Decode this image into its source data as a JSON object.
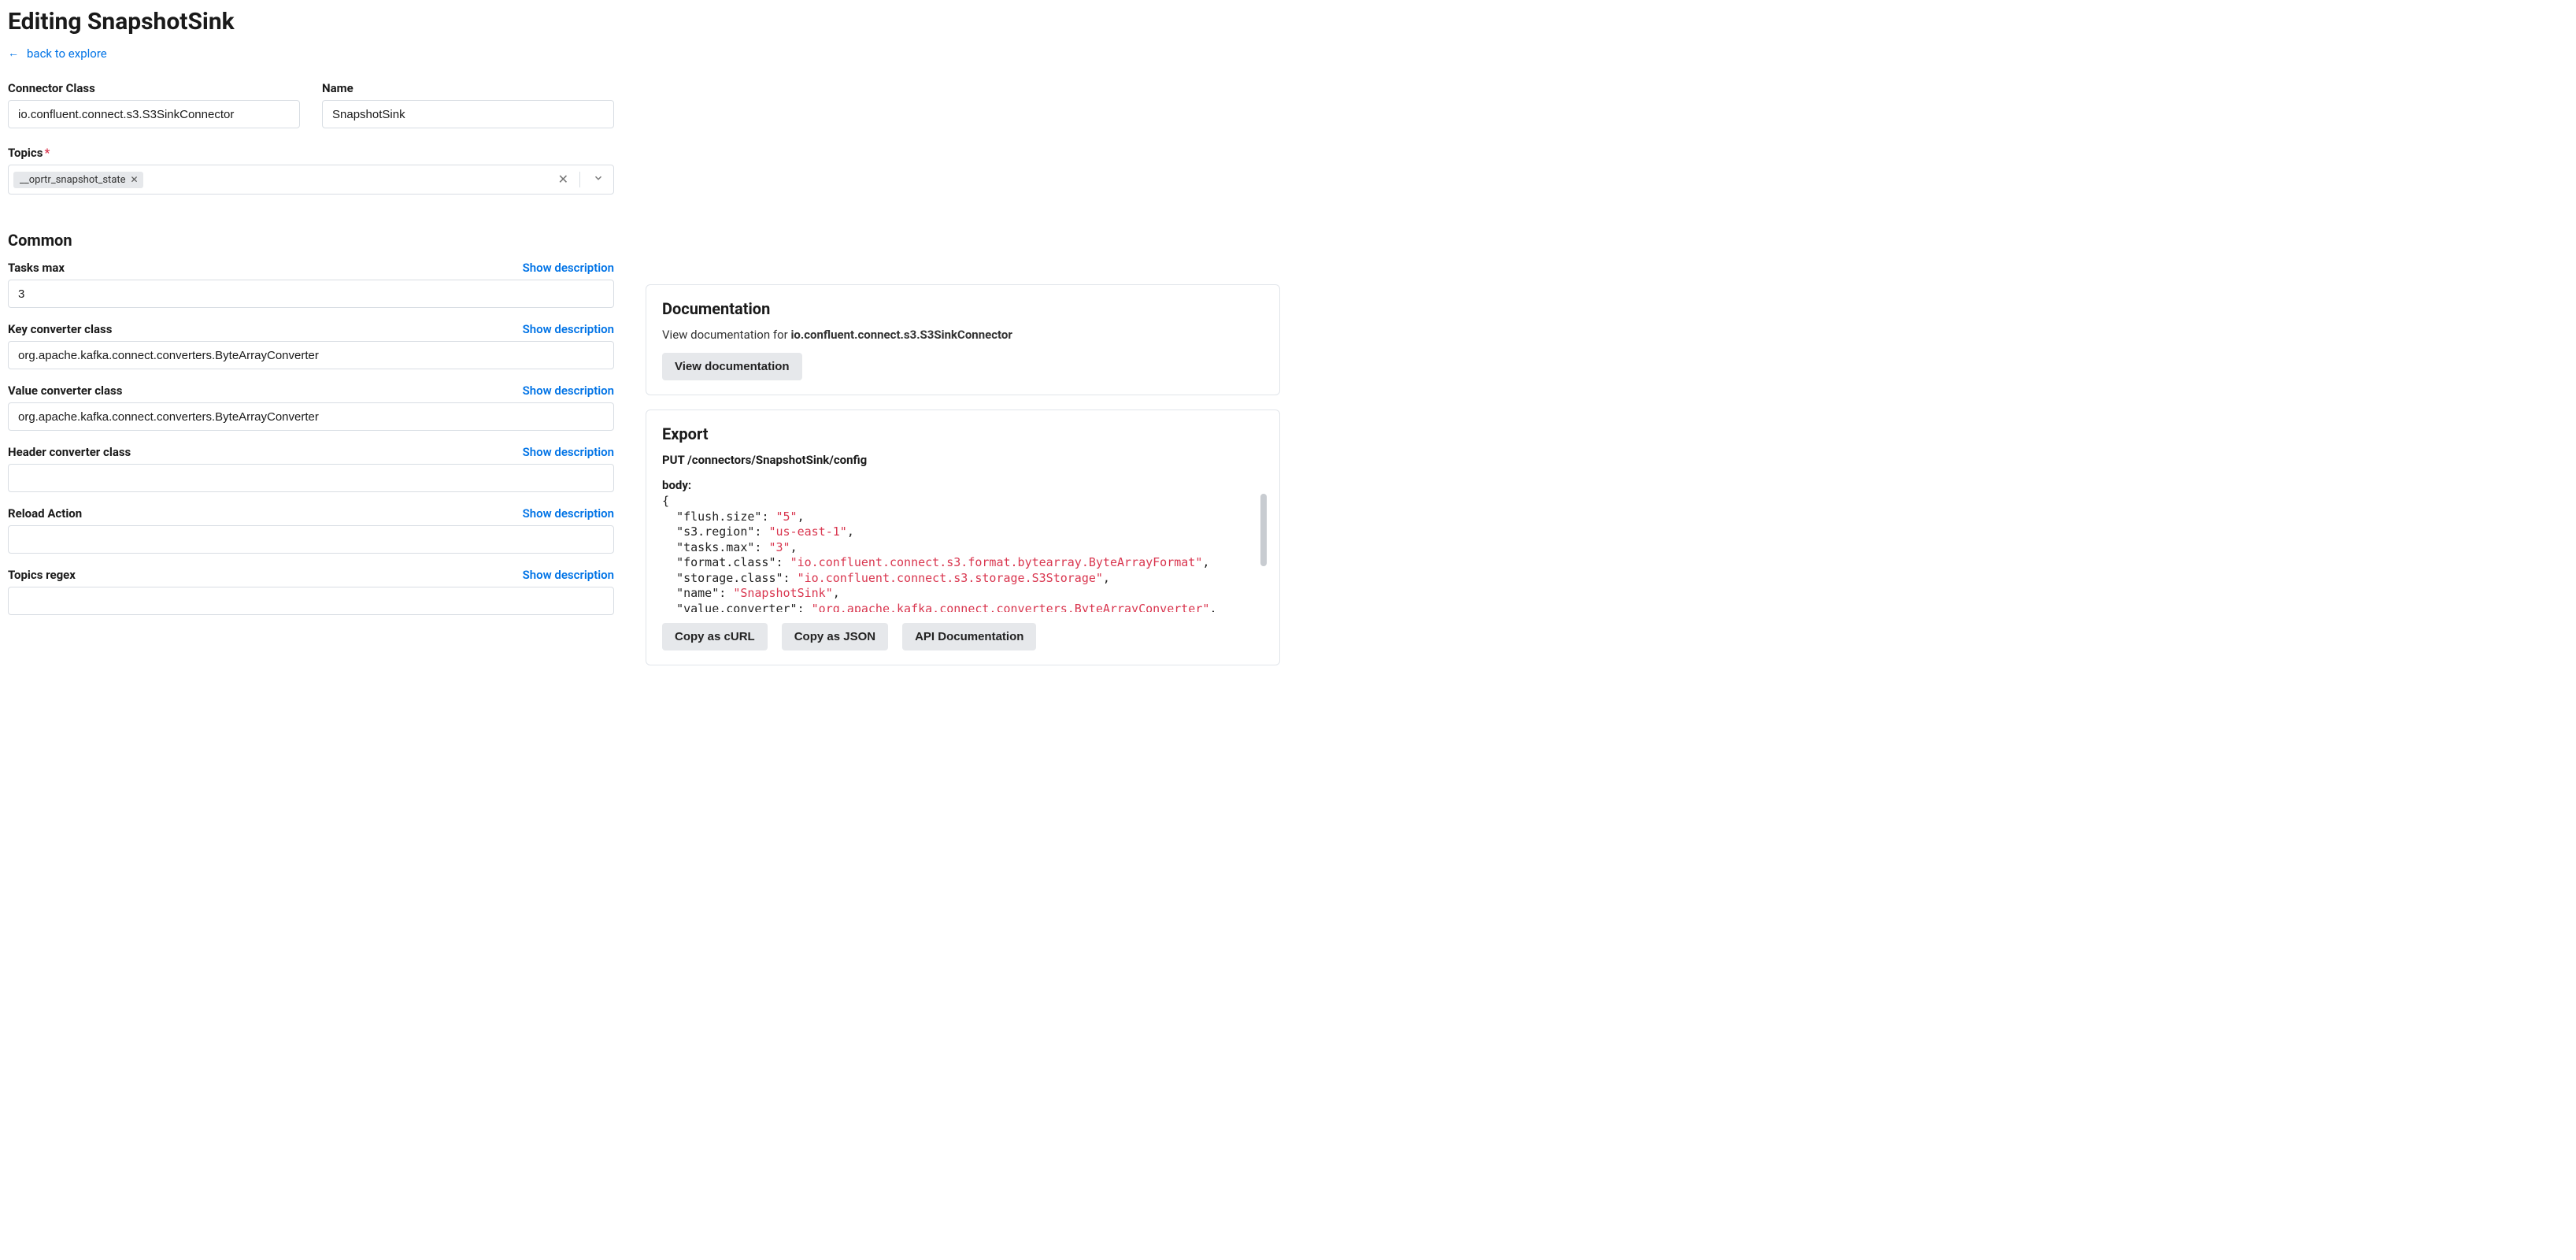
{
  "header": {
    "title": "Editing SnapshotSink",
    "back_label": "back to explore"
  },
  "fields": {
    "connector_class": {
      "label": "Connector Class",
      "value": "io.confluent.connect.s3.S3SinkConnector"
    },
    "name": {
      "label": "Name",
      "value": "SnapshotSink"
    },
    "topics": {
      "label": "Topics",
      "tag": "__oprtr_snapshot_state"
    }
  },
  "common": {
    "title": "Common",
    "show_desc": "Show description",
    "items": [
      {
        "label": "Tasks max",
        "value": "3"
      },
      {
        "label": "Key converter class",
        "value": "org.apache.kafka.connect.converters.ByteArrayConverter"
      },
      {
        "label": "Value converter class",
        "value": "org.apache.kafka.connect.converters.ByteArrayConverter"
      },
      {
        "label": "Header converter class",
        "value": ""
      },
      {
        "label": "Reload Action",
        "value": ""
      },
      {
        "label": "Topics regex",
        "value": ""
      }
    ]
  },
  "documentation": {
    "title": "Documentation",
    "text_prefix": "View documentation for ",
    "text_bold": "io.confluent.connect.s3.S3SinkConnector",
    "button": "View documentation"
  },
  "export": {
    "title": "Export",
    "method_line": "PUT /connectors/SnapshotSink/config",
    "body_label": "body:",
    "body": [
      [
        "flush.size",
        "5"
      ],
      [
        "s3.region",
        "us-east-1"
      ],
      [
        "tasks.max",
        "3"
      ],
      [
        "format.class",
        "io.confluent.connect.s3.format.bytearray.ByteArrayFormat"
      ],
      [
        "storage.class",
        "io.confluent.connect.s3.storage.S3Storage"
      ],
      [
        "name",
        "SnapshotSink"
      ],
      [
        "value.converter",
        "org.apache.kafka.connect.converters.ByteArrayConverter"
      ]
    ],
    "buttons": {
      "curl": "Copy as cURL",
      "json": "Copy as JSON",
      "api": "API Documentation"
    }
  }
}
